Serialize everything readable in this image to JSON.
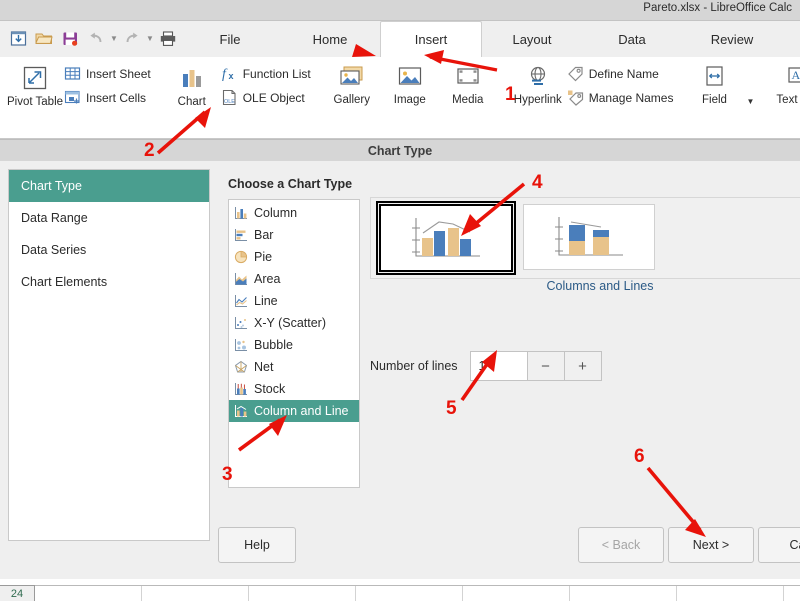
{
  "window": {
    "doc_title": "Pareto.xlsx - LibreOffice Calc"
  },
  "quick_access": [
    {
      "name": "save-as-icon",
      "label": "Save As"
    },
    {
      "name": "open-folder-icon",
      "label": "Open"
    },
    {
      "name": "save-icon",
      "label": "Save"
    },
    {
      "name": "undo-icon",
      "label": "Undo"
    },
    {
      "name": "redo-icon",
      "label": "Redo"
    },
    {
      "name": "print-icon",
      "label": "Print"
    }
  ],
  "tabs": [
    {
      "label": "File",
      "active": false
    },
    {
      "label": "Home",
      "active": false
    },
    {
      "label": "Insert",
      "active": true
    },
    {
      "label": "Layout",
      "active": false
    },
    {
      "label": "Data",
      "active": false
    },
    {
      "label": "Review",
      "active": false
    }
  ],
  "ribbon": {
    "pivot_table": "Pivot Table",
    "insert_sheet": "Insert Sheet",
    "insert_cells": "Insert Cells",
    "chart": "Chart",
    "function_list": "Function List",
    "ole_object": "OLE Object",
    "image": "Image",
    "gallery": "Gallery",
    "media": "Media",
    "hyperlink": "Hyperlink",
    "define_name": "Define Name",
    "manage_names": "Manage Names",
    "field": "Field",
    "text_box": "Text Box"
  },
  "dialog": {
    "title": "Chart Type",
    "steps": [
      {
        "label": "Chart Type",
        "active": true
      },
      {
        "label": "Data Range",
        "active": false
      },
      {
        "label": "Data Series",
        "active": false
      },
      {
        "label": "Chart Elements",
        "active": false
      }
    ],
    "choose_label": "Choose a Chart Type",
    "chart_types": [
      {
        "label": "Column",
        "icon": "column-chart-icon",
        "selected": false
      },
      {
        "label": "Bar",
        "icon": "bar-chart-icon",
        "selected": false
      },
      {
        "label": "Pie",
        "icon": "pie-chart-icon",
        "selected": false
      },
      {
        "label": "Area",
        "icon": "area-chart-icon",
        "selected": false
      },
      {
        "label": "Line",
        "icon": "line-chart-icon",
        "selected": false
      },
      {
        "label": "X-Y (Scatter)",
        "icon": "scatter-chart-icon",
        "selected": false
      },
      {
        "label": "Bubble",
        "icon": "bubble-chart-icon",
        "selected": false
      },
      {
        "label": "Net",
        "icon": "net-chart-icon",
        "selected": false
      },
      {
        "label": "Stock",
        "icon": "stock-chart-icon",
        "selected": false
      },
      {
        "label": "Column and Line",
        "icon": "column-and-line-chart-icon",
        "selected": true
      }
    ],
    "subtype_caption": "Columns and Lines",
    "subtypes": [
      {
        "name": "columns-and-lines-grouped",
        "selected": true
      },
      {
        "name": "columns-and-lines-stacked",
        "selected": false
      }
    ],
    "number_of_lines_label": "Number of lines",
    "number_of_lines_value": "1",
    "spin_down_label": "−",
    "spin_up_label": "+",
    "buttons": {
      "help": "Help",
      "back": "< Back",
      "next": "Next >",
      "cancel": "Can"
    }
  },
  "sheet": {
    "row_header": "24"
  },
  "annotations": [
    {
      "id": "1",
      "target": "hyperlink-button"
    },
    {
      "id": "2",
      "target": "chart-button"
    },
    {
      "id": "3",
      "target": "column-and-line-list-item"
    },
    {
      "id": "4",
      "target": "subtype-grouped-thumbnail"
    },
    {
      "id": "5",
      "target": "number-of-lines-input"
    },
    {
      "id": "6",
      "target": "next-button"
    },
    {
      "id": "arrow-insert-tab",
      "target": "tab-insert"
    }
  ],
  "colors": {
    "accent_teal": "#4a9e8f",
    "annotation_red": "#e8130a",
    "chart_blue": "#4a7ebb",
    "chart_tan": "#e8c38a"
  }
}
